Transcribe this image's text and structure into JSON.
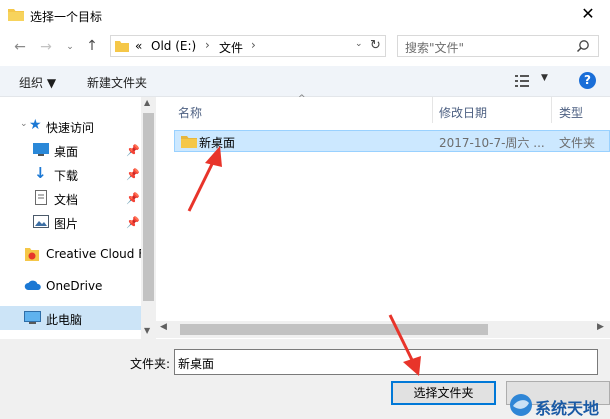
{
  "window": {
    "title": "选择一个目标"
  },
  "address": {
    "prefix": "«",
    "crumbs": [
      "Old (E:)",
      "文件"
    ]
  },
  "search": {
    "placeholder": "搜索\"文件\""
  },
  "toolbar": {
    "organize": "组织 ▼",
    "new_folder": "新建文件夹",
    "help": "?"
  },
  "sidebar": {
    "items": [
      {
        "label": "快速访问",
        "icon": "star-icon"
      },
      {
        "label": "桌面",
        "icon": "desktop-icon"
      },
      {
        "label": "下载",
        "icon": "download-icon"
      },
      {
        "label": "文档",
        "icon": "document-icon"
      },
      {
        "label": "图片",
        "icon": "picture-icon"
      },
      {
        "label": "Creative Cloud F",
        "icon": "creative-cloud-icon"
      },
      {
        "label": "OneDrive",
        "icon": "onedrive-icon"
      },
      {
        "label": "此电脑",
        "icon": "computer-icon"
      }
    ]
  },
  "columns": {
    "name": "名称",
    "modified": "修改日期",
    "type": "类型"
  },
  "files": [
    {
      "name": "新桌面",
      "modified": "2017-10-7-周六 ...",
      "type": "文件夹"
    }
  ],
  "bottom": {
    "filename_label": "文件夹:",
    "filename_value": "新桌面",
    "select_button": "选择文件夹"
  },
  "watermark": {
    "text": "系统天地"
  },
  "colors": {
    "accent": "#0078d7",
    "selection": "#cce8ff",
    "arrow": "#e8342a",
    "folder": "#f5c748"
  }
}
